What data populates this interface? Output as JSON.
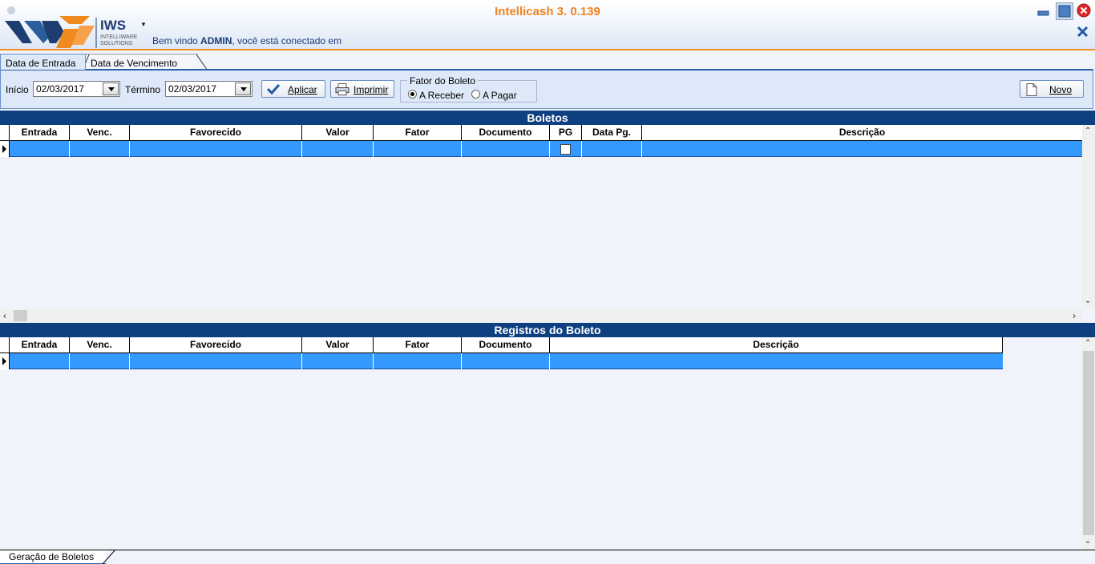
{
  "window": {
    "title": "Intellicash 3. 0.139",
    "controls": [
      "minimize-icon",
      "maximize-icon",
      "close-icon",
      "close-x-icon"
    ]
  },
  "header": {
    "logo_text": "IWS",
    "logo_sub1": "INTELLIWARE",
    "logo_sub2": "SOLUTIONS",
    "welcome_prefix": "Bem vindo ",
    "user": "ADMIN",
    "welcome_suffix": ", você está conectado em"
  },
  "tabs": [
    {
      "label": "Data de Entrada",
      "active": true
    },
    {
      "label": "Data de Vencimento",
      "active": false
    }
  ],
  "filter": {
    "inicio_label": "Início",
    "inicio_value": "02/03/2017",
    "termino_label": "Término",
    "termino_value": "02/03/2017",
    "aplicar_label": "Aplicar",
    "imprimir_label": "Imprimir",
    "fator_legend": "Fator do Boleto",
    "radio_receber": "A Receber",
    "radio_pagar": "A Pagar",
    "selected_radio": "A Receber",
    "novo_label": "Novo"
  },
  "boletos": {
    "title": "Boletos",
    "columns": [
      "Entrada",
      "Venc.",
      "Favorecido",
      "Valor",
      "Fator",
      "Documento",
      "PG",
      "Data Pg.",
      "Descrição"
    ],
    "rows": [
      {
        "entrada": "",
        "venc": "",
        "favorecido": "",
        "valor": "",
        "fator": "",
        "documento": "",
        "pg": false,
        "data_pg": "",
        "descricao": ""
      }
    ]
  },
  "registros": {
    "title": "Registros do Boleto",
    "columns": [
      "Entrada",
      "Venc.",
      "Favorecido",
      "Valor",
      "Fator",
      "Documento",
      "Descrição"
    ],
    "rows": [
      {
        "entrada": "",
        "venc": "",
        "favorecido": "",
        "valor": "",
        "fator": "",
        "documento": "",
        "descricao": ""
      }
    ]
  },
  "bottom_tabs": [
    {
      "label": "Geração de Boletos",
      "active": true
    }
  ],
  "colors": {
    "accent_orange": "#f0821e",
    "header_blue": "#0e3f80",
    "selected_row": "#3399ff"
  }
}
